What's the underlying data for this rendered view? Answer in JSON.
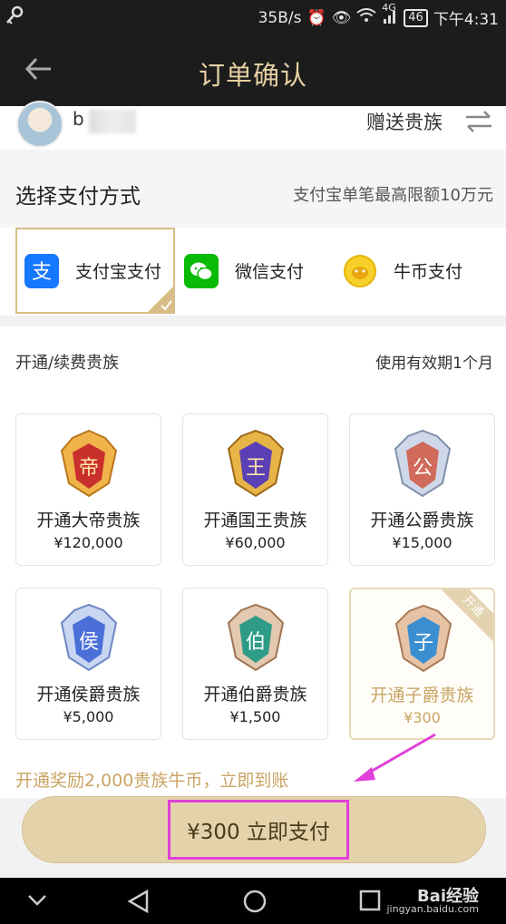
{
  "status_bar": {
    "speed": "35B/s",
    "network": "4G",
    "battery": "46",
    "time": "下午4:31"
  },
  "header": {
    "title": "订单确认"
  },
  "user": {
    "name_prefix": "b",
    "gift_label": "赠送贵族"
  },
  "payment": {
    "heading": "选择支付方式",
    "limit_note": "支付宝单笔最高限额10万元",
    "methods": [
      {
        "label": "支付宝支付",
        "icon": "alipay-icon",
        "color": "#1677ff",
        "selected": true
      },
      {
        "label": "微信支付",
        "icon": "wechat-icon",
        "color": "#09bb07",
        "selected": false
      },
      {
        "label": "牛币支付",
        "icon": "coin-icon",
        "color": "#f5c518",
        "selected": false
      }
    ]
  },
  "nobility": {
    "heading": "开通/续费贵族",
    "validity": "使用有效期1个月",
    "options": [
      {
        "name": "开通大帝贵族",
        "price": "¥120,000",
        "glyph": "帝",
        "color": "#c9302c"
      },
      {
        "name": "开通国王贵族",
        "price": "¥60,000",
        "glyph": "王",
        "color": "#5b3fb5"
      },
      {
        "name": "开通公爵贵族",
        "price": "¥15,000",
        "glyph": "公",
        "color": "#d06a5a"
      },
      {
        "name": "开通侯爵贵族",
        "price": "¥5,000",
        "glyph": "侯",
        "color": "#4a6fd8"
      },
      {
        "name": "开通伯爵贵族",
        "price": "¥1,500",
        "glyph": "伯",
        "color": "#2e9c86"
      },
      {
        "name": "开通子爵贵族",
        "price": "¥300",
        "glyph": "子",
        "color": "#3b8fd0",
        "selected": true,
        "ribbon": "开通"
      }
    ]
  },
  "reward_text": "开通奖励2,000贵族牛币，立即到账",
  "pay_button": {
    "label": "¥300 立即支付"
  },
  "watermark": {
    "brand": "Bai经验",
    "url": "jingyan.baidu.com"
  },
  "colors": {
    "accent": "#c9a463",
    "button": "#e4d2ab",
    "highlight": "#e03fd9"
  }
}
